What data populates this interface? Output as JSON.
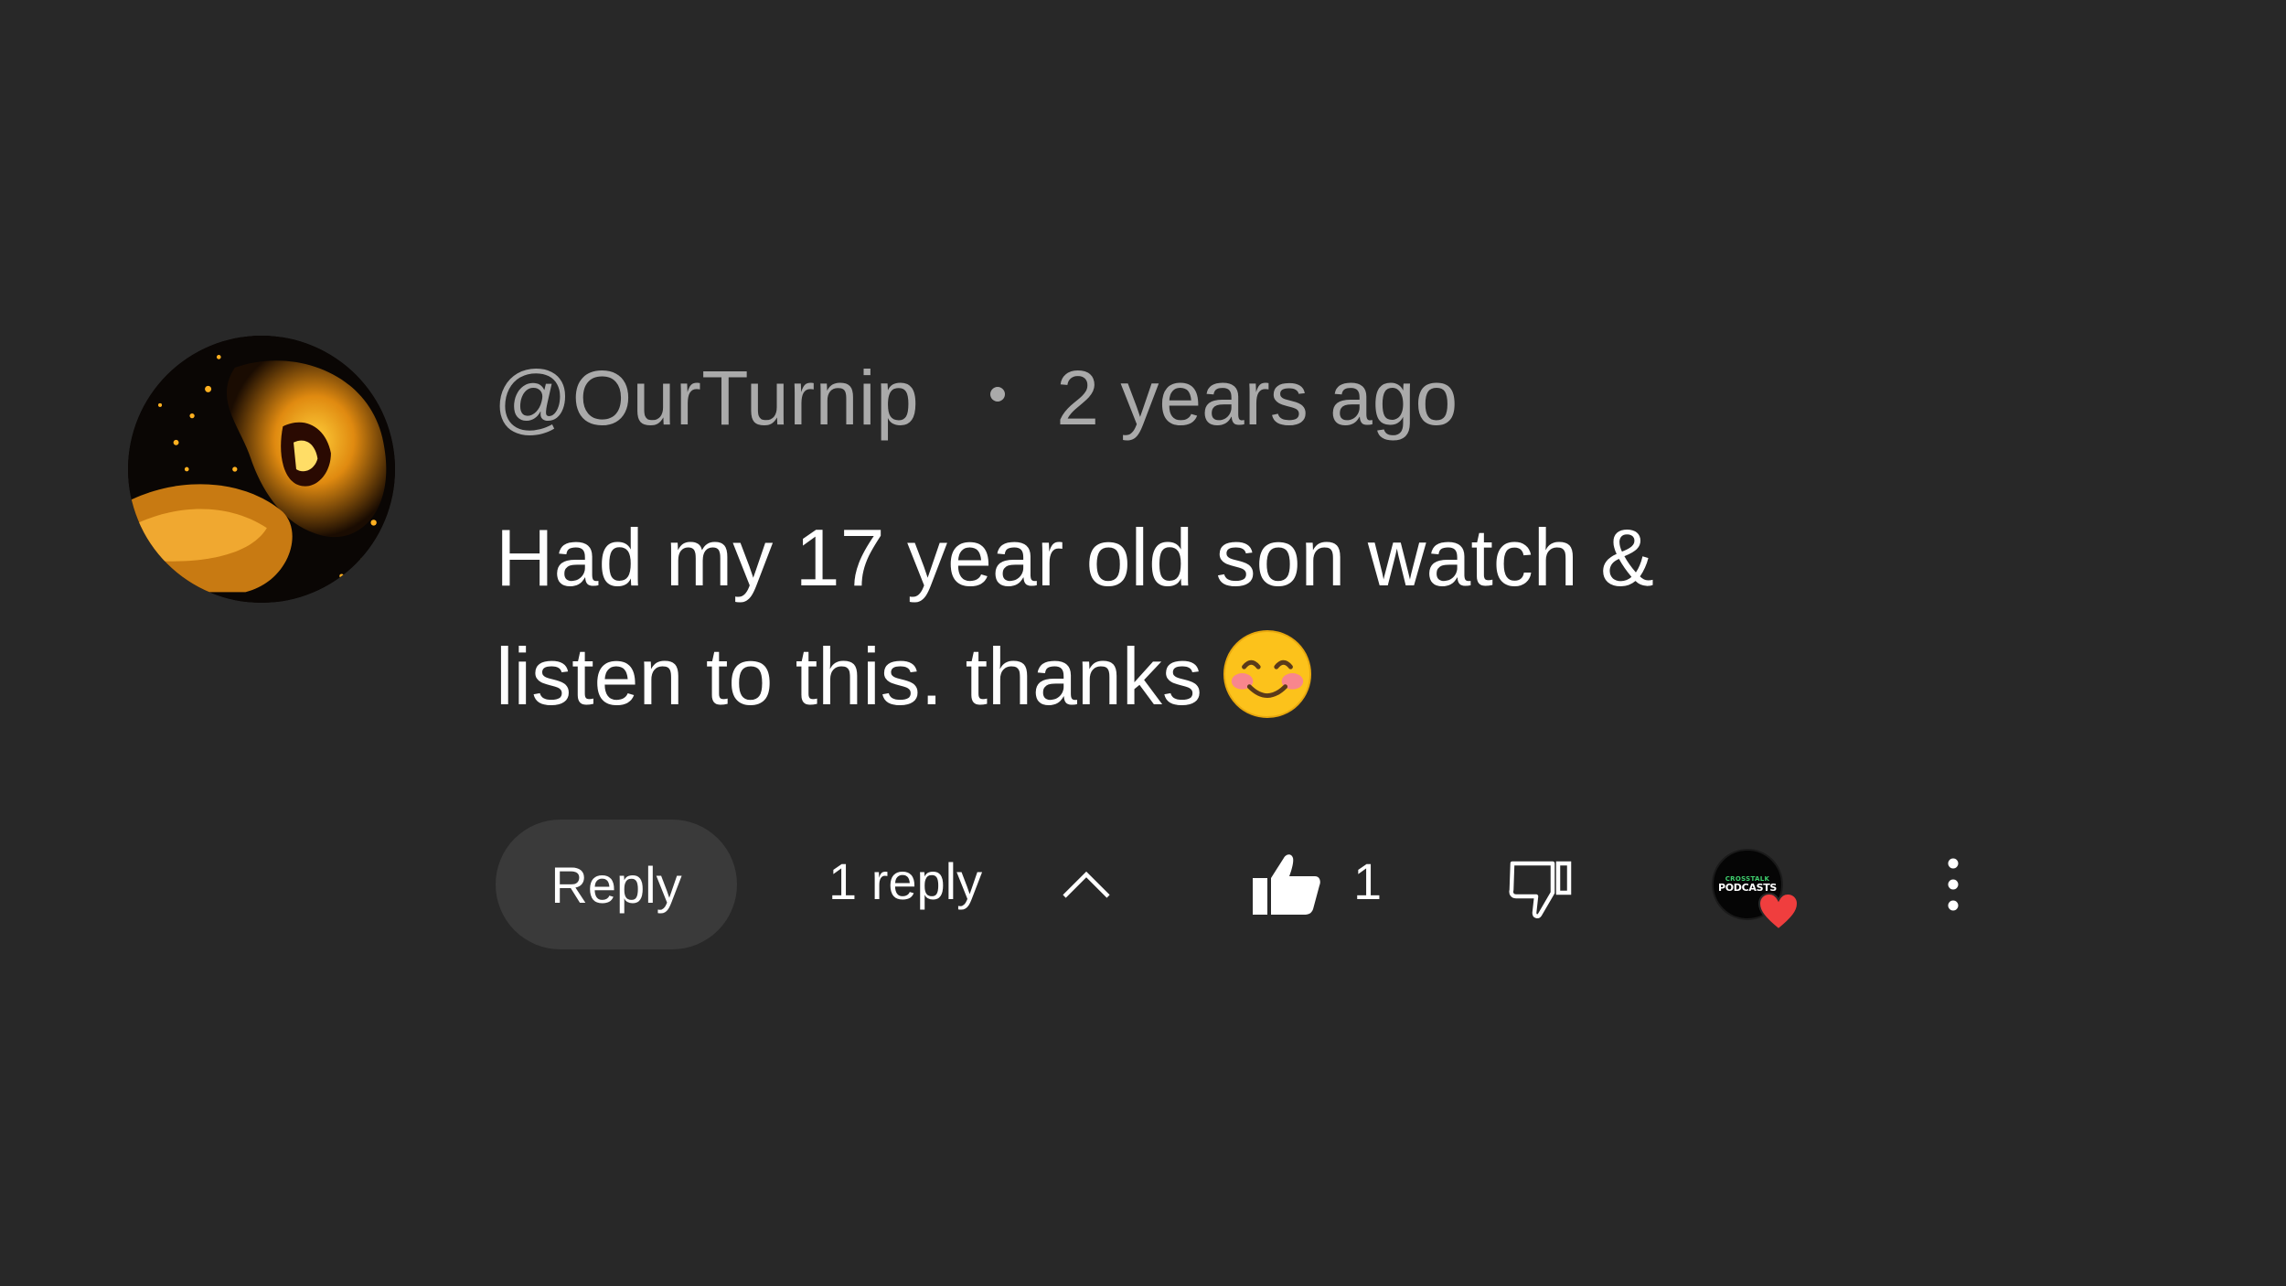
{
  "comment": {
    "author": "@OurTurnip",
    "timestamp": "2 years ago",
    "text_line1": "Had my 17 year old son watch &",
    "text_line2": "listen to this. thanks",
    "emoji": "smiling-face-with-smiling-eyes"
  },
  "actions": {
    "reply_label": "Reply",
    "replies_label": "1 reply",
    "like_count": "1",
    "creator_heart": {
      "channel_line1": "CROSSTALK",
      "channel_line2": "PODCASTS",
      "heart_color": "#f03e3e"
    }
  },
  "colors": {
    "background": "#282828",
    "secondary_text": "#aaaaaa",
    "primary_text": "#ffffff",
    "reply_button_bg": "#3a3a3a"
  },
  "icons": {
    "avatar": "roaring-lion-avatar",
    "collapse": "chevron-up-icon",
    "like": "thumbs-up-icon",
    "dislike": "thumbs-down-icon",
    "more": "more-vertical-icon"
  }
}
